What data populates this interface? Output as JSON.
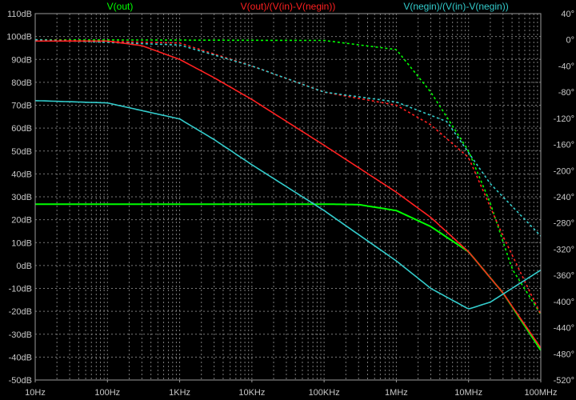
{
  "chart_data": {
    "type": "line",
    "title": "",
    "legend": [
      "V(out)",
      "V(out)/(V(in)-V(negin))",
      "V(negin)/(V(in)-V(negin))"
    ],
    "legend_placement": "top",
    "x_axis": {
      "scale": "log",
      "range_hz": [
        10,
        100000000
      ],
      "tick_values": [
        10,
        100,
        1000,
        10000,
        100000,
        1000000,
        10000000,
        100000000
      ],
      "tick_labels": [
        "10Hz",
        "100Hz",
        "1KHz",
        "10KHz",
        "100KHz",
        "1MHz",
        "10MHz",
        "100MHz"
      ]
    },
    "y_left_axis": {
      "unit": "dB",
      "range": [
        -50,
        110
      ],
      "tick_values": [
        110,
        100,
        90,
        80,
        70,
        60,
        50,
        40,
        30,
        20,
        10,
        0,
        -10,
        -20,
        -30,
        -40,
        -50
      ],
      "tick_labels": [
        "110dB",
        "100dB",
        "90dB",
        "80dB",
        "70dB",
        "60dB",
        "50dB",
        "40dB",
        "30dB",
        "20dB",
        "10dB",
        "0dB",
        "-10dB",
        "-20dB",
        "-30dB",
        "-40dB",
        "-50dB"
      ]
    },
    "y_right_axis": {
      "unit": "degrees",
      "range": [
        -520,
        40
      ],
      "tick_values": [
        40,
        0,
        -40,
        -80,
        -120,
        -160,
        -200,
        -240,
        -280,
        -320,
        -360,
        -400,
        -440,
        -480,
        -520
      ],
      "tick_labels": [
        "40°",
        "0°",
        "-40°",
        "-80°",
        "-120°",
        "-160°",
        "-200°",
        "-240°",
        "-280°",
        "-320°",
        "-360°",
        "-400°",
        "-440°",
        "-480°",
        "-520°"
      ]
    },
    "grid": true,
    "colors": {
      "background": "#000000",
      "grid": "#7a7a7a",
      "tick_text": "#c8c8c8",
      "axis": "#9a9a9a",
      "v_out": "#00ff00",
      "loop_gain": "#ff2020",
      "feedback": "#33cccc"
    },
    "series": [
      {
        "legend_index": 0,
        "color": "#00ff00",
        "magnitude_db": [
          [
            10,
            26.8
          ],
          [
            100,
            26.8
          ],
          [
            1000,
            26.8
          ],
          [
            10000,
            26.8
          ],
          [
            100000,
            26.8
          ],
          [
            300000,
            26.6
          ],
          [
            1000000,
            24
          ],
          [
            3000000,
            17
          ],
          [
            10000000,
            6
          ],
          [
            30000000,
            -12
          ],
          [
            100000000,
            -37
          ]
        ],
        "phase_deg": [
          [
            10,
            0
          ],
          [
            100000,
            -1
          ],
          [
            1000000,
            -15
          ],
          [
            3000000,
            -80
          ],
          [
            10000000,
            -170
          ],
          [
            20000000,
            -250
          ],
          [
            40000000,
            -350
          ],
          [
            100000000,
            -420
          ]
        ]
      },
      {
        "legend_index": 1,
        "color": "#ff2020",
        "magnitude_db": [
          [
            10,
            98
          ],
          [
            100,
            98
          ],
          [
            300,
            96
          ],
          [
            1000,
            90
          ],
          [
            3000,
            82
          ],
          [
            10000,
            72.5
          ],
          [
            100000,
            52.5
          ],
          [
            1000000,
            32
          ],
          [
            3000000,
            21
          ],
          [
            10000000,
            6
          ],
          [
            30000000,
            -12
          ],
          [
            100000000,
            -36
          ]
        ],
        "phase_deg": [
          [
            10,
            0
          ],
          [
            1000,
            -5
          ],
          [
            10000,
            -40
          ],
          [
            100000,
            -80
          ],
          [
            1000000,
            -100
          ],
          [
            3000000,
            -130
          ],
          [
            10000000,
            -180
          ],
          [
            30000000,
            -300
          ],
          [
            100000000,
            -420
          ]
        ]
      },
      {
        "legend_index": 2,
        "color": "#33cccc",
        "magnitude_db": [
          [
            10,
            72
          ],
          [
            100,
            71
          ],
          [
            1000,
            64
          ],
          [
            3000,
            55
          ],
          [
            10000,
            44
          ],
          [
            100000,
            24
          ],
          [
            1000000,
            2
          ],
          [
            3000000,
            -10
          ],
          [
            10000000,
            -19
          ],
          [
            20000000,
            -16
          ],
          [
            100000000,
            -2
          ]
        ],
        "phase_deg": [
          [
            10,
            0
          ],
          [
            1000,
            -8
          ],
          [
            10000,
            -40
          ],
          [
            100000,
            -80
          ],
          [
            1000000,
            -95
          ],
          [
            5000000,
            -125
          ],
          [
            20000000,
            -220
          ],
          [
            100000000,
            -300
          ]
        ]
      }
    ]
  }
}
